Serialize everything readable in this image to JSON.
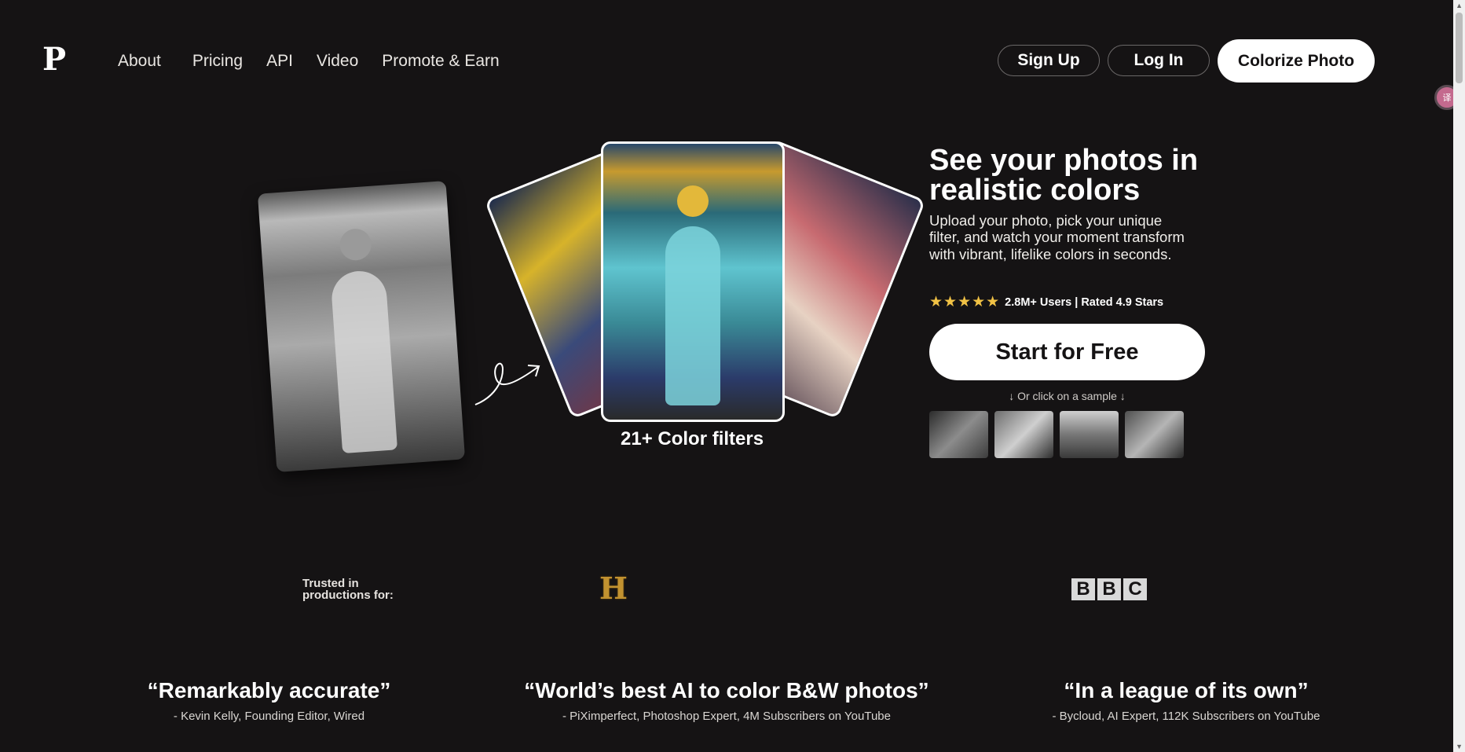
{
  "header": {
    "logo": "P",
    "nav": [
      "About",
      "Pricing",
      "API",
      "Video",
      "Promote & Earn"
    ],
    "signup": "Sign Up",
    "login": "Log In",
    "colorize": "Colorize Photo"
  },
  "hero": {
    "title": "See your photos in realistic colors",
    "subtitle": "Upload your photo, pick your unique filter, and watch your moment transform with vibrant, lifelike colors in seconds.",
    "stars": "★★★★★",
    "rating": "2.8M+ Users | Rated 4.9 Stars",
    "cta": "Start for Free",
    "sample_hint": "↓ Or click on a sample ↓",
    "filters_label": "21+ Color filters"
  },
  "trusted": {
    "label": "Trusted in productions for:",
    "history": "H",
    "bbc": [
      "B",
      "B",
      "C"
    ]
  },
  "quotes": [
    {
      "text": "“Remarkably accurate”",
      "author": "- Kevin Kelly, Founding Editor, Wired"
    },
    {
      "text": "“World’s best AI to color B&W photos”",
      "author": "- PiXimperfect, Photoshop Expert, 4M Subscribers on YouTube"
    },
    {
      "text": "“In a league of its own”",
      "author": "- Bycloud, AI Expert, 112K Subscribers on YouTube"
    }
  ],
  "colors": {
    "background": "#151314",
    "star": "#f1c245",
    "history_gold": "#c29230"
  }
}
